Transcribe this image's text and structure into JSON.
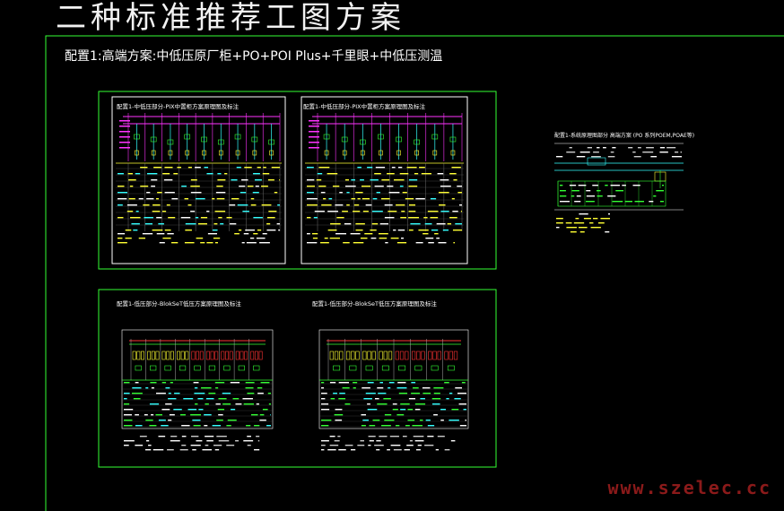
{
  "page": {
    "title": "二种标准推荐工图方案",
    "subtitle": "配置1:高端方案:中低压原厂柜+PO+POI Plus+千里眼+中低压测温"
  },
  "sheets": [
    {
      "title": "配置1-中低压部分-PIX中置柜方案原理图及标注"
    },
    {
      "title": "配置1-中低压部分-PIX中置柜方案原理图及标注"
    },
    {
      "title": "配置1-低压部分-BlokSeT低压方案原理图及标注"
    },
    {
      "title": "配置1-低压部分-BlokSeT低压方案原理图及标注"
    },
    {
      "title": "配置1-系统原理图部分  高端方案 (PO 系列POEM,POAE等)"
    }
  ],
  "watermark": "www.szelec.cc",
  "colors": {
    "frame": "#33ff33",
    "sheet_border": "#ffffff",
    "magenta": "#ff33ff",
    "cyan": "#33ffff",
    "yellow": "#ffff33",
    "green": "#33ff33",
    "red": "#ff3333"
  }
}
